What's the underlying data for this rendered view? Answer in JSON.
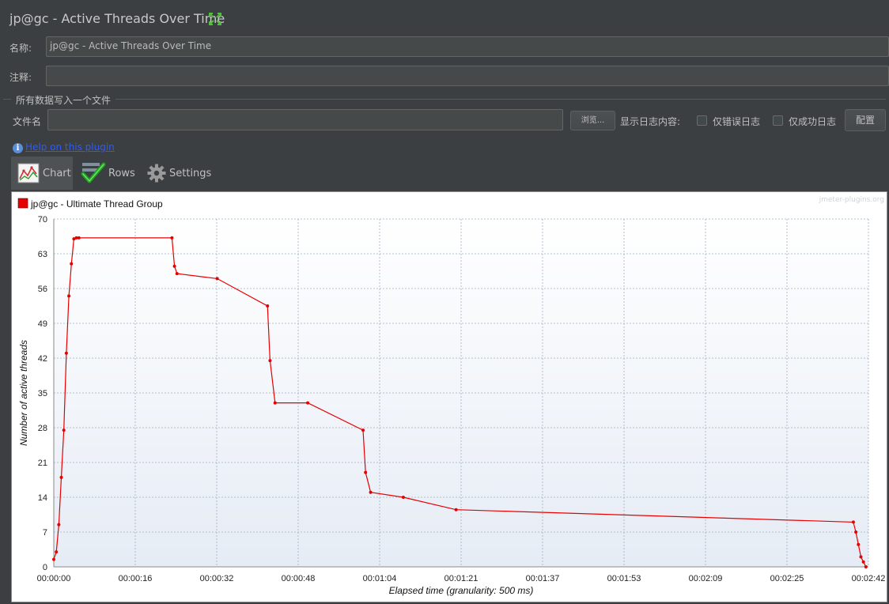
{
  "window": {
    "title": "jp@gc - Active Threads Over Time"
  },
  "form": {
    "name_label": "名称:",
    "name_value": "jp@gc - Active Threads Over Time",
    "comment_label": "注释:",
    "comment_value": "",
    "file_section_label": "所有数据写入一个文件",
    "filename_label": "文件名",
    "filename_value": "",
    "browse_label": "浏览...",
    "log_display_label": "显示日志内容:",
    "errors_only_label": "仅错误日志",
    "success_only_label": "仅成功日志",
    "configure_label": "配置"
  },
  "help": {
    "icon_text": "i",
    "link_text": "Help on this plugin"
  },
  "tabs": [
    {
      "label": "Chart",
      "icon": "chart-icon",
      "selected": true
    },
    {
      "label": "Rows",
      "icon": "checkmark-icon",
      "selected": false
    },
    {
      "label": "Settings",
      "icon": "gear-icon",
      "selected": false
    }
  ],
  "chart_data": {
    "type": "line",
    "watermark": "jmeter-plugins.org",
    "xlabel": "Elapsed time (granularity: 500 ms)",
    "ylabel": "Number of active threads",
    "ylim": [
      0,
      70
    ],
    "xlim": [
      0,
      162
    ],
    "y_ticks": [
      "0",
      "7",
      "14",
      "21",
      "28",
      "35",
      "42",
      "49",
      "56",
      "63",
      "70"
    ],
    "x_ticks": [
      "00:00:00",
      "00:00:16",
      "00:00:32",
      "00:00:48",
      "00:01:04",
      "00:01:21",
      "00:01:37",
      "00:01:53",
      "00:02:09",
      "00:02:25",
      "00:02:42"
    ],
    "grid": true,
    "legend_position": "top-left",
    "series": [
      {
        "name": "jp@gc - Ultimate Thread Group",
        "color": "#e60000",
        "x": [
          0,
          0.5,
          1,
          1.5,
          2,
          2.5,
          3,
          3.5,
          4,
          4.5,
          5,
          23.5,
          24,
          24.5,
          32.5,
          42.5,
          43,
          44,
          50.5,
          61.5,
          62,
          63,
          69.5,
          80,
          159,
          159.5,
          160,
          160.5,
          161,
          161.5
        ],
        "y": [
          1.5,
          3,
          8.5,
          18,
          27.5,
          43,
          54.5,
          61,
          66,
          66.2,
          66.2,
          66.2,
          60.5,
          59,
          58,
          52.5,
          41.5,
          33,
          33,
          27.5,
          19,
          15,
          14,
          11.5,
          9,
          7,
          4.5,
          2,
          1,
          0
        ]
      }
    ]
  }
}
